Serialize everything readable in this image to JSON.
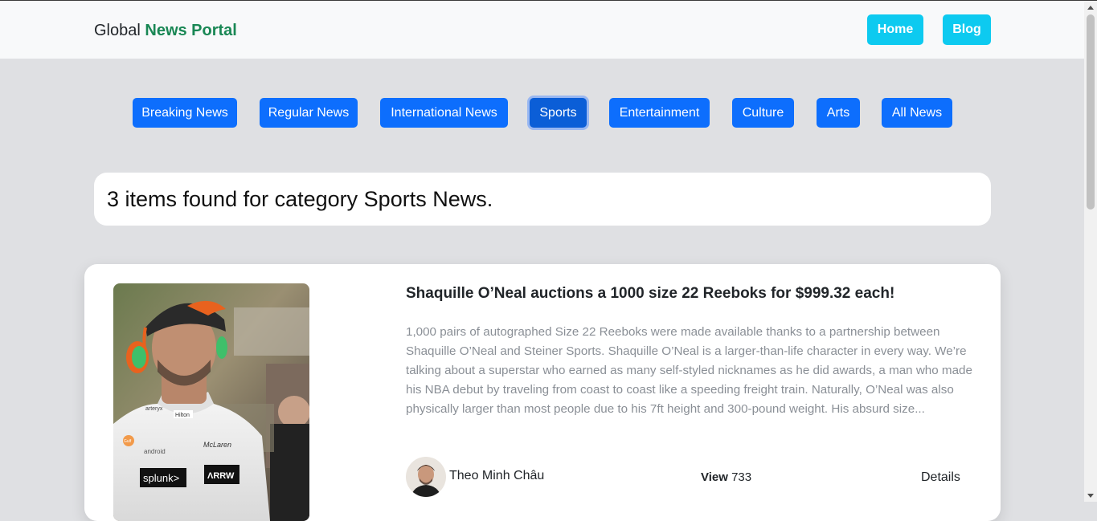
{
  "navbar": {
    "brand_prefix": "Global",
    "brand_accent": "News Portal",
    "links": [
      "Home",
      "Blog"
    ]
  },
  "categories": [
    "Breaking News",
    "Regular News",
    "International News",
    "Sports",
    "Entertainment",
    "Culture",
    "Arts",
    "All News"
  ],
  "active_category": "Sports",
  "result_text": "3 items found for category Sports News.",
  "article": {
    "title": "Shaquille O’Neal auctions a 1000 size 22 Reeboks for $999.32 each!",
    "excerpt": "1,000 pairs of autographed Size 22 Reeboks were made available thanks to a partnership between Shaquille O’Neal and Steiner Sports. Shaquille O’Neal is a larger-than-life character in every way. We’re talking about a superstar who earned as many self-styled nicknames as he did awards, a man who made his NBA debut by traveling from coast to coast like a speeding freight train. Naturally, O’Neal was also physically larger than most people due to his 7ft height and 300-pound weight. His absurd size...",
    "author": "Theo Minh Châu",
    "view_label": "View",
    "view_count": "733",
    "details_label": "Details",
    "photo_sponsors": [
      "splunk>",
      "ΛRRW",
      "McLaren",
      "Gulf",
      "android",
      "Hilton",
      "arteryx"
    ]
  },
  "colors": {
    "page_bg": "#dfe0e3",
    "navbar_bg": "#f8f9fa",
    "brand_accent": "#198754",
    "nav_button": "#0dcaf0",
    "category_button": "#0d6efd",
    "excerpt_text": "#8a8f96"
  }
}
